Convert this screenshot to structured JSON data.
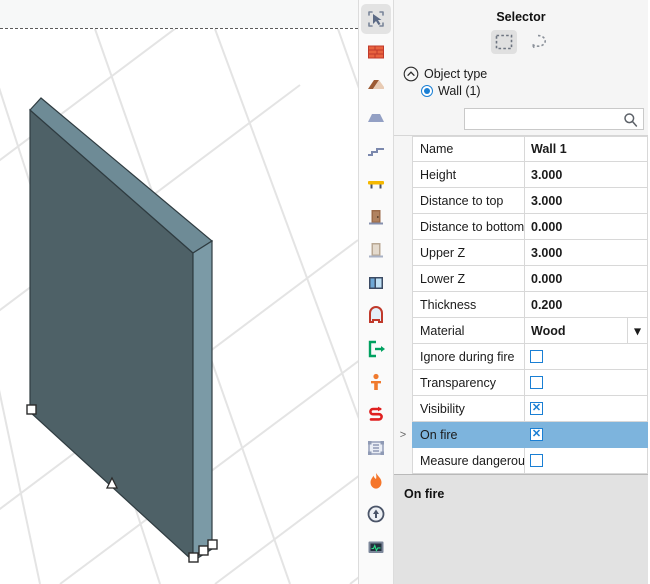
{
  "viewport": {
    "name": "3d-viewport",
    "object_color_front": "#4e6167",
    "object_color_top": "#6e8b96",
    "object_color_side": "#7b9aa6",
    "grid_color": "#e4e4e4",
    "background": "#ffffff",
    "top_band_color": "#f7f8f8"
  },
  "toolbar": {
    "items": [
      {
        "icon": "selector-arrow-icon",
        "label": "Selector",
        "active": true
      },
      {
        "icon": "wall-brick-icon",
        "label": "Wall",
        "active": false
      },
      {
        "icon": "roof-icon",
        "label": "Roof",
        "active": false
      },
      {
        "icon": "ceiling-slab-icon",
        "label": "Ceiling",
        "active": false
      },
      {
        "icon": "stairs-icon",
        "label": "Stairs",
        "active": false
      },
      {
        "icon": "table-furniture-icon",
        "label": "Furniture",
        "active": false
      },
      {
        "icon": "door-brown-icon",
        "label": "Door",
        "active": false
      },
      {
        "icon": "door-light-icon",
        "label": "Interior door",
        "active": false
      },
      {
        "icon": "window-icon",
        "label": "Window",
        "active": false
      },
      {
        "icon": "opening-icon",
        "label": "Opening",
        "active": false
      },
      {
        "icon": "exit-sign-icon",
        "label": "Exit",
        "active": false
      },
      {
        "icon": "person-icon",
        "label": "Occupant",
        "active": false
      },
      {
        "icon": "path-route-icon",
        "label": "Route",
        "active": false
      },
      {
        "icon": "disabled-frame-icon",
        "label": "Disabled tool",
        "active": false
      },
      {
        "icon": "flame-icon",
        "label": "Fire",
        "active": false
      },
      {
        "icon": "detector-icon",
        "label": "Detector",
        "active": false
      },
      {
        "icon": "monitor-sensor-icon",
        "label": "Sensor",
        "active": false
      }
    ]
  },
  "panel": {
    "title": "Selector",
    "selection_modes": [
      {
        "name": "rectangle-select",
        "icon": "rectangle-marquee-icon",
        "active": true
      },
      {
        "name": "lasso-select",
        "icon": "lasso-select-icon",
        "active": false
      }
    ],
    "object_type": {
      "collapse_icon": "chevron-up-circle-icon",
      "label": "Object type",
      "options": [
        {
          "label": "Wall (1)",
          "selected": true
        }
      ]
    },
    "search": {
      "value": "",
      "placeholder": "",
      "icon": "search-icon"
    },
    "properties": [
      {
        "name": "Name",
        "value": "Wall 1",
        "type": "text",
        "selected": false,
        "expander": ""
      },
      {
        "name": "Height",
        "value": "3.000",
        "type": "text",
        "selected": false,
        "expander": ""
      },
      {
        "name": "Distance to top",
        "value": "3.000",
        "type": "text",
        "selected": false,
        "expander": ""
      },
      {
        "name": "Distance to bottom",
        "value": "0.000",
        "type": "text",
        "selected": false,
        "expander": ""
      },
      {
        "name": "Upper Z",
        "value": "3.000",
        "type": "text",
        "selected": false,
        "expander": ""
      },
      {
        "name": "Lower Z",
        "value": "0.000",
        "type": "text",
        "selected": false,
        "expander": ""
      },
      {
        "name": "Thickness",
        "value": "0.200",
        "type": "text",
        "selected": false,
        "expander": ""
      },
      {
        "name": "Material",
        "value": "Wood",
        "type": "dropdown",
        "selected": false,
        "expander": ""
      },
      {
        "name": "Ignore during fire",
        "value": "",
        "type": "checkbox",
        "checked": false,
        "selected": false,
        "expander": ""
      },
      {
        "name": "Transparency",
        "value": "",
        "type": "checkbox",
        "checked": false,
        "selected": false,
        "expander": ""
      },
      {
        "name": "Visibility",
        "value": "",
        "type": "checkbox",
        "checked": true,
        "selected": false,
        "expander": ""
      },
      {
        "name": "On fire",
        "value": "",
        "type": "checkbox",
        "checked": true,
        "selected": true,
        "expander": ">"
      },
      {
        "name": "Measure dangerous",
        "value": "",
        "type": "checkbox",
        "checked": false,
        "selected": false,
        "expander": ""
      }
    ],
    "checkbox_mark": "✕",
    "dropdown_caret": "▾",
    "description": {
      "title": "On fire"
    },
    "accent_color": "#1a7fd4",
    "selected_row_color": "#7db4dd"
  }
}
